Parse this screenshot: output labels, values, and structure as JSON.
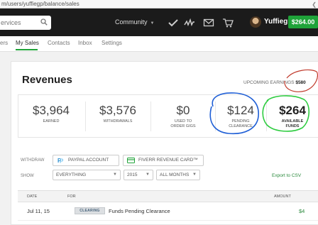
{
  "browser": {
    "url": "m/users/yuffiegp/balance/sales"
  },
  "topnav": {
    "search_placeholder": "ervices",
    "community_label": "Community",
    "username": "Yuffiegp",
    "balance": "$264.00",
    "icons": [
      "check-icon",
      "activity-icon",
      "envelope-icon",
      "cart-icon"
    ]
  },
  "subnav": {
    "items": [
      "ers",
      "My Sales",
      "Contacts",
      "Inbox",
      "Settings"
    ],
    "active": "My Sales"
  },
  "revenues": {
    "title": "Revenues",
    "upcoming_label": "UPCOMING EARNINGS",
    "upcoming_value": "$580",
    "stats": [
      {
        "value": "$3,964",
        "label": "EARNED"
      },
      {
        "value": "$3,576",
        "label": "WITHDRAWALS"
      },
      {
        "value": "$0",
        "label": "USED TO ORDER GIGS"
      },
      {
        "value": "$124",
        "label": "PENDING CLEARANCE"
      },
      {
        "value": "$264",
        "label": "AVAILABLE FUNDS"
      }
    ]
  },
  "controls": {
    "withdraw_label": "WITHDRAW",
    "paypal_label": "PAYPAL ACCOUNT",
    "revenue_card_label": "FIVERR REVENUE CARD™",
    "show_label": "SHOW",
    "filter_type": "EVERYTHING",
    "filter_year": "2015",
    "filter_month": "ALL MONTHS",
    "export_label": "Export to CSV"
  },
  "table": {
    "headers": {
      "date": "DATE",
      "for": "FOR",
      "amount": "AMOUNT"
    },
    "rows": [
      {
        "date": "Jul 11, 15",
        "badge": "CLEARING",
        "description": "Funds Pending Clearance",
        "amount": "$4"
      }
    ]
  },
  "colors": {
    "brand_green": "#1fa339",
    "nav_bg": "#1b1b1b",
    "annotation_red": "#c0392b",
    "annotation_blue": "#1f5fd6",
    "annotation_green": "#2ecc40"
  }
}
